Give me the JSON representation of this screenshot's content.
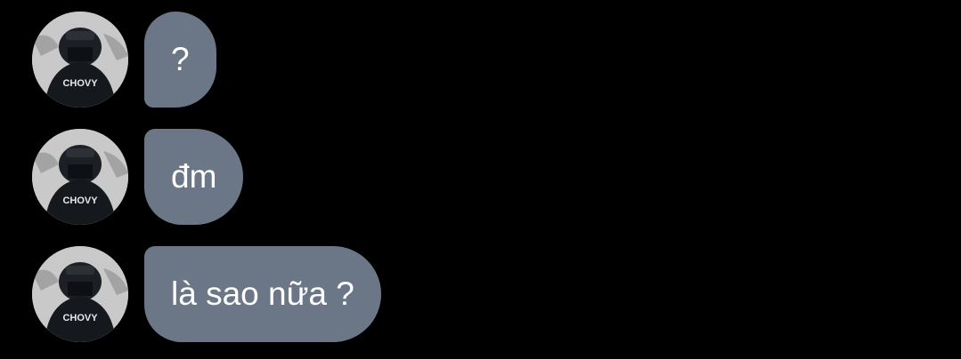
{
  "messages": [
    {
      "text": "?",
      "avatar": "profile-avatar",
      "avatar_label": "CHOVY"
    },
    {
      "text": "đm",
      "avatar": "profile-avatar",
      "avatar_label": "CHOVY"
    },
    {
      "text": "là sao nữa ?",
      "avatar": "profile-avatar",
      "avatar_label": "CHOVY"
    }
  ],
  "colors": {
    "background": "#000000",
    "bubble": "#6b7787",
    "text": "#ffffff"
  }
}
